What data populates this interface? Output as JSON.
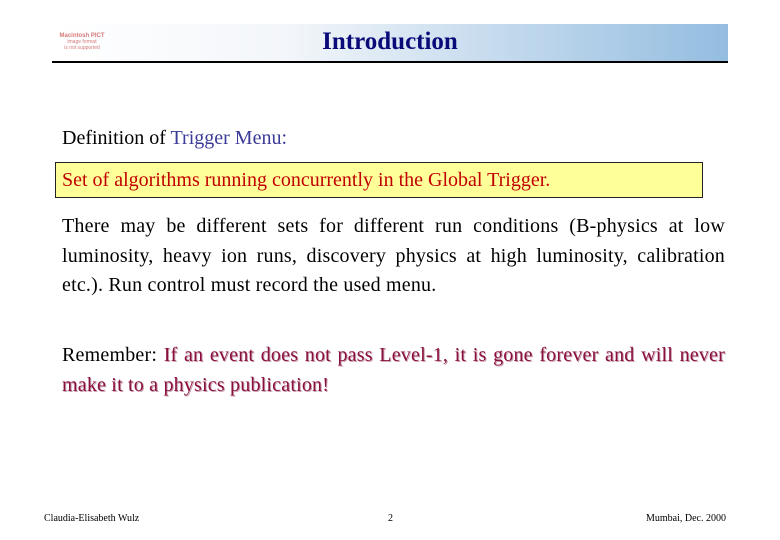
{
  "header": {
    "title": "Introduction",
    "pict_placeholder": {
      "line1": "Macintosh PICT",
      "line2": "image format",
      "line3": "is not supported"
    }
  },
  "definition": {
    "prefix": "Definition of ",
    "term": "Trigger Menu:",
    "box_text": "Set of algorithms running concurrently in the Global Trigger."
  },
  "paragraph": "There may be different sets for different run conditions (B-physics at low luminosity, heavy ion runs, discovery physics at high luminosity, calibration etc.). Run control must record the used menu.",
  "remember": {
    "label": "Remember: ",
    "message": "If an event does not pass Level-1, it is gone forever and will never make it to a physics publication!"
  },
  "footer": {
    "author": "Claudia-Elisabeth Wulz",
    "page": "2",
    "venue_date": "Mumbai, Dec. 2000"
  },
  "colors": {
    "title": "#0a0a78",
    "term": "#3a3a98",
    "box_text": "#c00000",
    "box_bg": "#ffff99",
    "remember_message": "#8a1040"
  }
}
